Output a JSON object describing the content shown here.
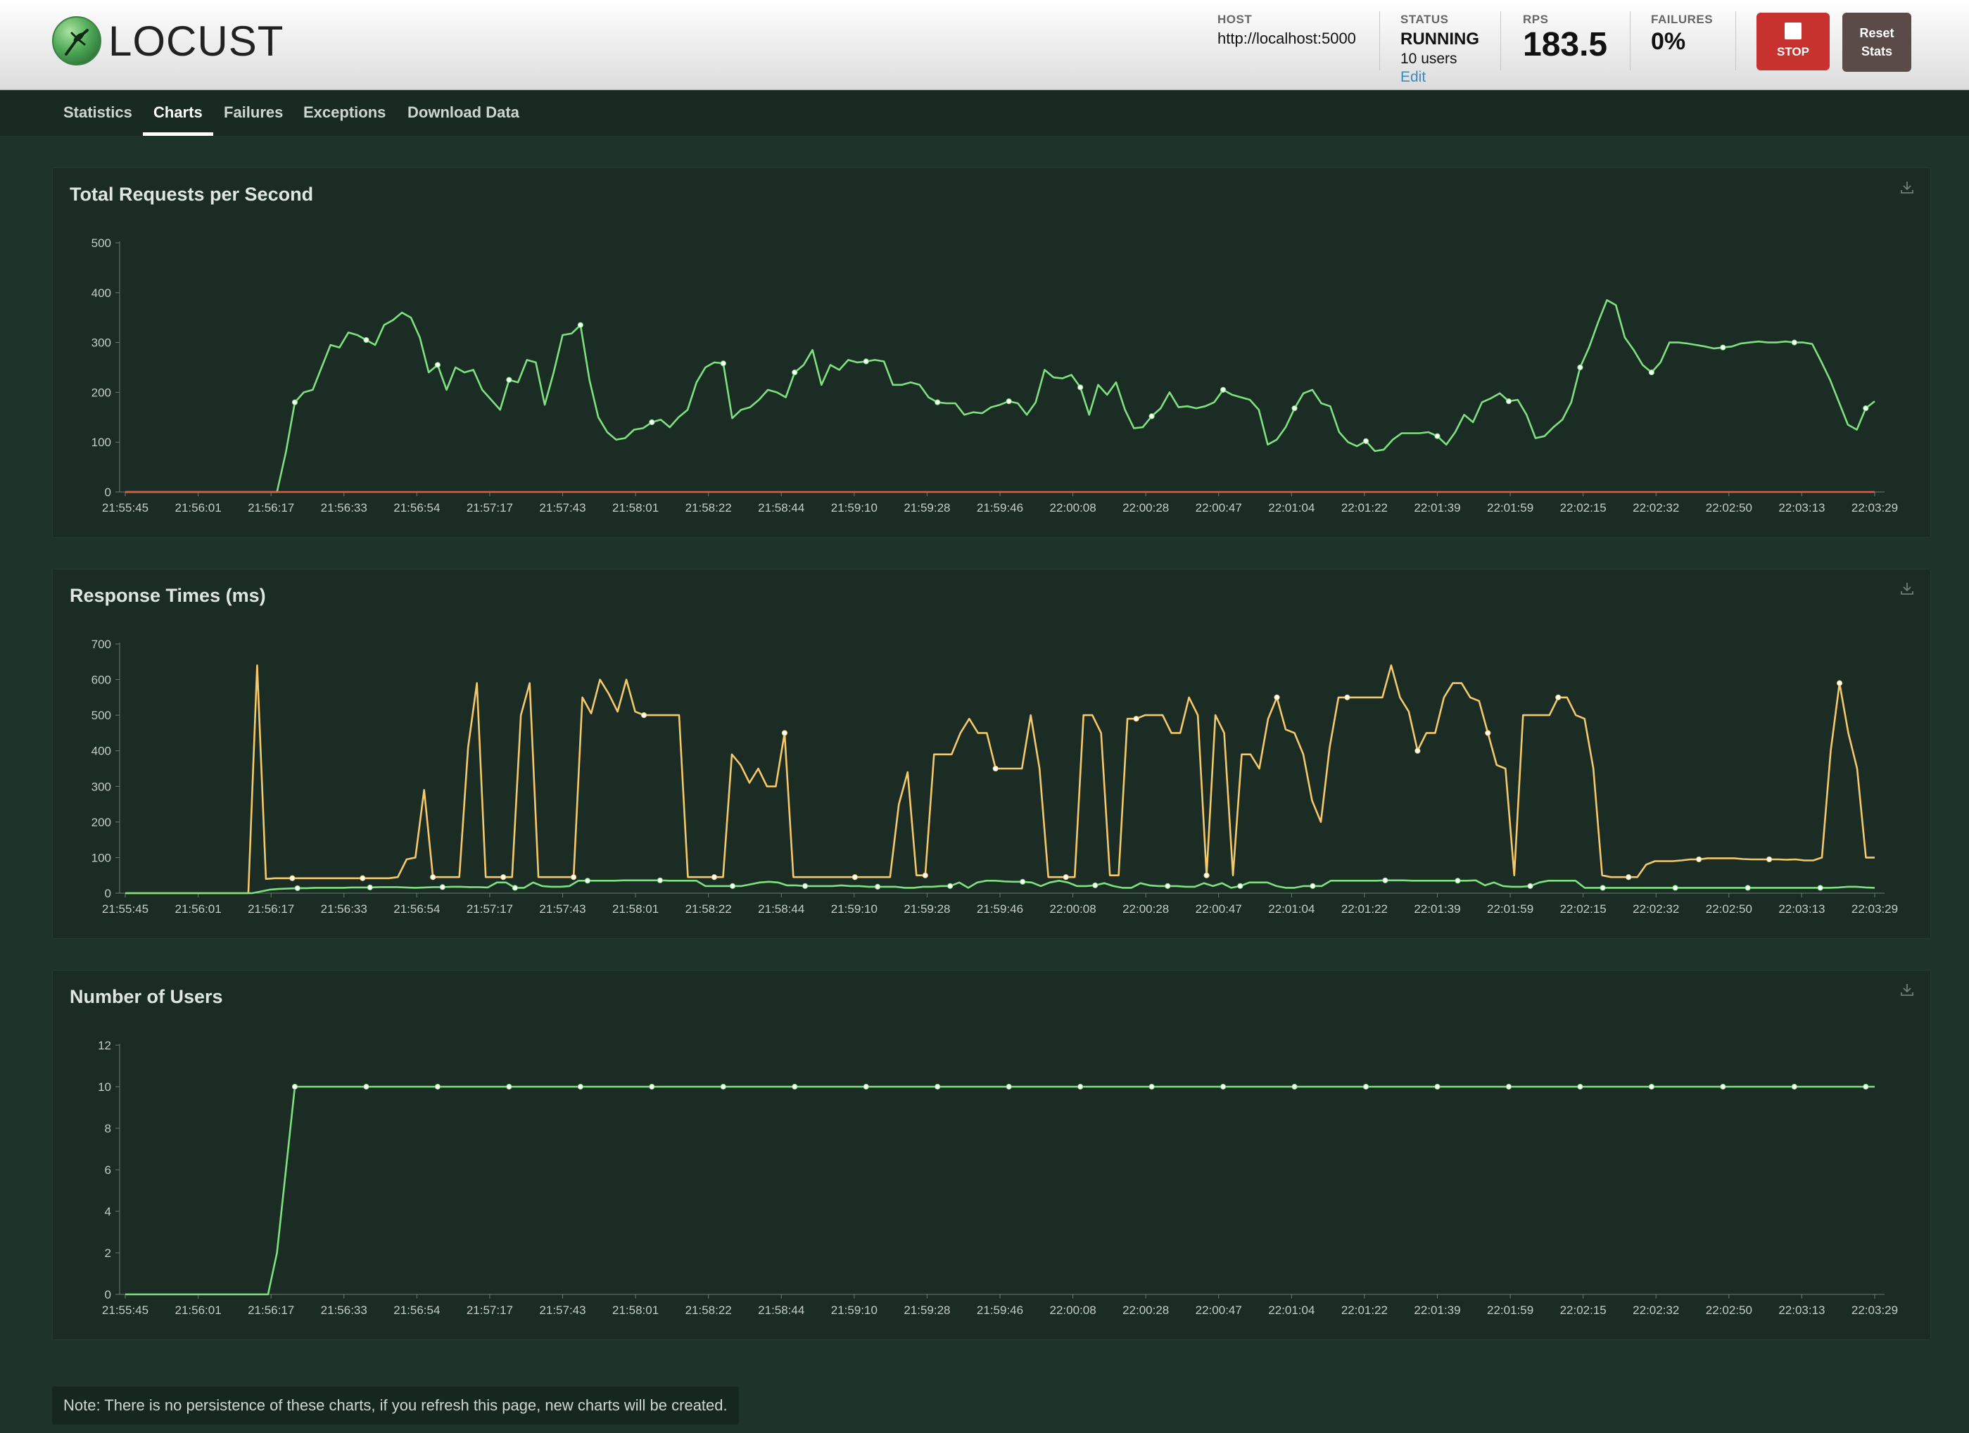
{
  "app": {
    "logo_text": "LOCUST"
  },
  "header": {
    "host_label": "HOST",
    "host_value": "http://localhost:5000",
    "status_label": "STATUS",
    "status_value": "RUNNING",
    "users_value": "10 users",
    "edit_link": "Edit",
    "rps_label": "RPS",
    "rps_value": "183.5",
    "failures_label": "FAILURES",
    "failures_value": "0%",
    "stop_label": "STOP",
    "reset_label_line1": "Reset",
    "reset_label_line2": "Stats"
  },
  "nav": {
    "tabs": [
      {
        "label": "Statistics",
        "active": false
      },
      {
        "label": "Charts",
        "active": true
      },
      {
        "label": "Failures",
        "active": false
      },
      {
        "label": "Exceptions",
        "active": false
      },
      {
        "label": "Download Data",
        "active": false
      }
    ]
  },
  "note": "Note: There is no persistence of these charts, if you refresh this page, new charts will be created.",
  "chart_data": [
    {
      "type": "line",
      "title": "Total Requests per Second",
      "ylim": [
        0,
        500
      ],
      "yticks": [
        0,
        100,
        200,
        300,
        400,
        500
      ],
      "xticks": [
        "21:55:45",
        "21:56:01",
        "21:56:17",
        "21:56:33",
        "21:56:54",
        "21:57:17",
        "21:57:43",
        "21:58:01",
        "21:58:22",
        "21:58:44",
        "21:59:10",
        "21:59:28",
        "21:59:46",
        "22:00:08",
        "22:00:28",
        "22:00:47",
        "22:01:04",
        "22:01:22",
        "22:01:39",
        "22:01:59",
        "22:02:15",
        "22:02:32",
        "22:02:50",
        "22:03:13",
        "22:03:29"
      ],
      "grid": false,
      "series": [
        {
          "color": "#7fe07f",
          "values": [
            0,
            0,
            0,
            0,
            0,
            0,
            0,
            0,
            0,
            0,
            0,
            0,
            0,
            0,
            0,
            0,
            0,
            0,
            80,
            180,
            200,
            205,
            250,
            295,
            290,
            320,
            315,
            305,
            295,
            335,
            345,
            360,
            350,
            310,
            240,
            255,
            205,
            250,
            240,
            245,
            205,
            185,
            165,
            225,
            220,
            265,
            260,
            175,
            240,
            315,
            318,
            335,
            225,
            150,
            120,
            105,
            108,
            125,
            128,
            140,
            145,
            130,
            150,
            165,
            220,
            250,
            260,
            258,
            148,
            165,
            170,
            185,
            205,
            200,
            190,
            240,
            255,
            285,
            215,
            255,
            245,
            265,
            260,
            262,
            265,
            262,
            215,
            215,
            220,
            215,
            190,
            180,
            178,
            178,
            155,
            160,
            158,
            170,
            175,
            182,
            178,
            155,
            180,
            245,
            230,
            228,
            235,
            210,
            155,
            215,
            195,
            220,
            165,
            128,
            130,
            152,
            168,
            200,
            170,
            172,
            168,
            172,
            180,
            205,
            195,
            190,
            185,
            165,
            95,
            105,
            130,
            168,
            198,
            205,
            178,
            172,
            120,
            100,
            92,
            102,
            82,
            85,
            105,
            118,
            118,
            118,
            120,
            112,
            95,
            120,
            155,
            140,
            180,
            188,
            198,
            182,
            185,
            155,
            108,
            112,
            130,
            145,
            180,
            250,
            290,
            340,
            385,
            375,
            310,
            285,
            255,
            240,
            260,
            300,
            300,
            298,
            295,
            292,
            288,
            290,
            292,
            298,
            300,
            302,
            300,
            300,
            302,
            300,
            300,
            297,
            262,
            225,
            180,
            135,
            125,
            168,
            182
          ]
        },
        {
          "color": "#e05a4a",
          "values": [
            0,
            0
          ]
        }
      ]
    },
    {
      "type": "line",
      "title": "Response Times (ms)",
      "ylim": [
        0,
        700
      ],
      "yticks": [
        0,
        100,
        200,
        300,
        400,
        500,
        600,
        700
      ],
      "xticks": [
        "21:55:45",
        "21:56:01",
        "21:56:17",
        "21:56:33",
        "21:56:54",
        "21:57:17",
        "21:57:43",
        "21:58:01",
        "21:58:22",
        "21:58:44",
        "21:59:10",
        "21:59:28",
        "21:59:46",
        "22:00:08",
        "22:00:28",
        "22:00:47",
        "22:01:04",
        "22:01:22",
        "22:01:39",
        "22:01:59",
        "22:02:15",
        "22:02:32",
        "22:02:50",
        "22:03:13",
        "22:03:29"
      ],
      "grid": false,
      "series": [
        {
          "color": "#f5c96b",
          "values": [
            0,
            0,
            0,
            0,
            0,
            0,
            0,
            0,
            0,
            0,
            0,
            0,
            0,
            0,
            0,
            640,
            40,
            42,
            42,
            42,
            42,
            42,
            42,
            42,
            42,
            42,
            42,
            42,
            42,
            42,
            42,
            45,
            95,
            100,
            290,
            45,
            45,
            45,
            45,
            410,
            590,
            45,
            45,
            45,
            45,
            500,
            590,
            45,
            45,
            45,
            45,
            45,
            550,
            505,
            600,
            560,
            510,
            600,
            510,
            500,
            500,
            500,
            500,
            500,
            45,
            45,
            45,
            45,
            45,
            390,
            360,
            310,
            350,
            300,
            300,
            450,
            45,
            45,
            45,
            45,
            45,
            45,
            45,
            45,
            45,
            45,
            45,
            45,
            250,
            340,
            50,
            50,
            390,
            390,
            390,
            450,
            490,
            450,
            450,
            350,
            350,
            350,
            350,
            500,
            350,
            45,
            45,
            45,
            45,
            500,
            500,
            450,
            50,
            50,
            490,
            490,
            500,
            500,
            500,
            450,
            450,
            550,
            500,
            50,
            500,
            450,
            50,
            390,
            390,
            350,
            490,
            550,
            460,
            450,
            390,
            260,
            200,
            410,
            550,
            550,
            550,
            550,
            550,
            550,
            640,
            550,
            510,
            400,
            450,
            450,
            550,
            590,
            590,
            550,
            540,
            450,
            360,
            350,
            50,
            500,
            500,
            500,
            500,
            550,
            550,
            500,
            490,
            350,
            50,
            45,
            45,
            45,
            45,
            80,
            90,
            90,
            90,
            92,
            95,
            95,
            98,
            98,
            98,
            98,
            96,
            95,
            95,
            95,
            95,
            94,
            95,
            92,
            92,
            100,
            400,
            590,
            450,
            350,
            100,
            100
          ]
        },
        {
          "color": "#7fe07f",
          "values": [
            0,
            0,
            0,
            0,
            0,
            0,
            0,
            0,
            0,
            0,
            0,
            0,
            0,
            0,
            0,
            5,
            10,
            12,
            13,
            14,
            14,
            15,
            15,
            15,
            15,
            16,
            16,
            16,
            17,
            17,
            17,
            16,
            15,
            16,
            17,
            17,
            18,
            18,
            17,
            17,
            16,
            30,
            30,
            15,
            15,
            30,
            20,
            18,
            18,
            20,
            35,
            35,
            35,
            35,
            35,
            36,
            36,
            36,
            36,
            36,
            35,
            35,
            35,
            35,
            20,
            20,
            20,
            20,
            20,
            25,
            30,
            32,
            30,
            22,
            22,
            20,
            20,
            20,
            20,
            22,
            20,
            20,
            18,
            18,
            18,
            18,
            15,
            15,
            18,
            18,
            20,
            20,
            30,
            15,
            30,
            35,
            35,
            33,
            32,
            32,
            30,
            20,
            30,
            35,
            30,
            20,
            20,
            22,
            28,
            20,
            15,
            15,
            28,
            22,
            20,
            20,
            20,
            18,
            18,
            28,
            20,
            28,
            15,
            20,
            30,
            30,
            30,
            20,
            15,
            15,
            20,
            20,
            20,
            35,
            35,
            35,
            35,
            35,
            35,
            36,
            36,
            36,
            35,
            35,
            35,
            35,
            35,
            35,
            35,
            36,
            22,
            30,
            20,
            18,
            18,
            20,
            30,
            35,
            35,
            35,
            35,
            15,
            15,
            15,
            15,
            15,
            15,
            15,
            15,
            15,
            15,
            15,
            15,
            15,
            15,
            15,
            15,
            15,
            15,
            15,
            15,
            15,
            15,
            15,
            15,
            15,
            15,
            15,
            15,
            16,
            18,
            18,
            16,
            15
          ]
        }
      ]
    },
    {
      "type": "line",
      "title": "Number of Users",
      "ylim": [
        0,
        12
      ],
      "yticks": [
        0,
        2,
        4,
        6,
        8,
        10,
        12
      ],
      "xticks": [
        "21:55:45",
        "21:56:01",
        "21:56:17",
        "21:56:33",
        "21:56:54",
        "21:57:17",
        "21:57:43",
        "21:58:01",
        "21:58:22",
        "21:58:44",
        "21:59:10",
        "21:59:28",
        "21:59:46",
        "22:00:08",
        "22:00:28",
        "22:00:47",
        "22:01:04",
        "22:01:22",
        "22:01:39",
        "22:01:59",
        "22:02:15",
        "22:02:32",
        "22:02:50",
        "22:03:13",
        "22:03:29"
      ],
      "grid": false,
      "series": [
        {
          "color": "#7fe07f",
          "values": [
            0,
            0,
            0,
            0,
            0,
            0,
            0,
            0,
            0,
            0,
            0,
            0,
            0,
            0,
            0,
            0,
            0,
            2,
            6,
            10,
            10,
            10,
            10,
            10,
            10,
            10,
            10,
            10,
            10,
            10,
            10,
            10,
            10,
            10,
            10,
            10,
            10,
            10,
            10,
            10,
            10,
            10,
            10,
            10,
            10,
            10,
            10,
            10,
            10,
            10,
            10,
            10,
            10,
            10,
            10,
            10,
            10,
            10,
            10,
            10,
            10,
            10,
            10,
            10,
            10,
            10,
            10,
            10,
            10,
            10,
            10,
            10,
            10,
            10,
            10,
            10,
            10,
            10,
            10,
            10,
            10,
            10,
            10,
            10,
            10,
            10,
            10,
            10,
            10,
            10,
            10,
            10,
            10,
            10,
            10,
            10,
            10,
            10,
            10,
            10,
            10,
            10,
            10,
            10,
            10,
            10,
            10,
            10,
            10,
            10,
            10,
            10,
            10,
            10,
            10,
            10,
            10,
            10,
            10,
            10,
            10,
            10,
            10,
            10,
            10,
            10,
            10,
            10,
            10,
            10,
            10,
            10,
            10,
            10,
            10,
            10,
            10,
            10,
            10,
            10,
            10,
            10,
            10,
            10,
            10,
            10,
            10,
            10,
            10,
            10,
            10,
            10,
            10,
            10,
            10,
            10,
            10,
            10,
            10,
            10,
            10,
            10,
            10,
            10,
            10,
            10,
            10,
            10,
            10,
            10,
            10,
            10,
            10,
            10,
            10,
            10,
            10,
            10,
            10,
            10,
            10,
            10,
            10,
            10,
            10,
            10,
            10,
            10,
            10,
            10,
            10,
            10,
            10,
            10,
            10,
            10,
            10
          ]
        }
      ]
    }
  ]
}
